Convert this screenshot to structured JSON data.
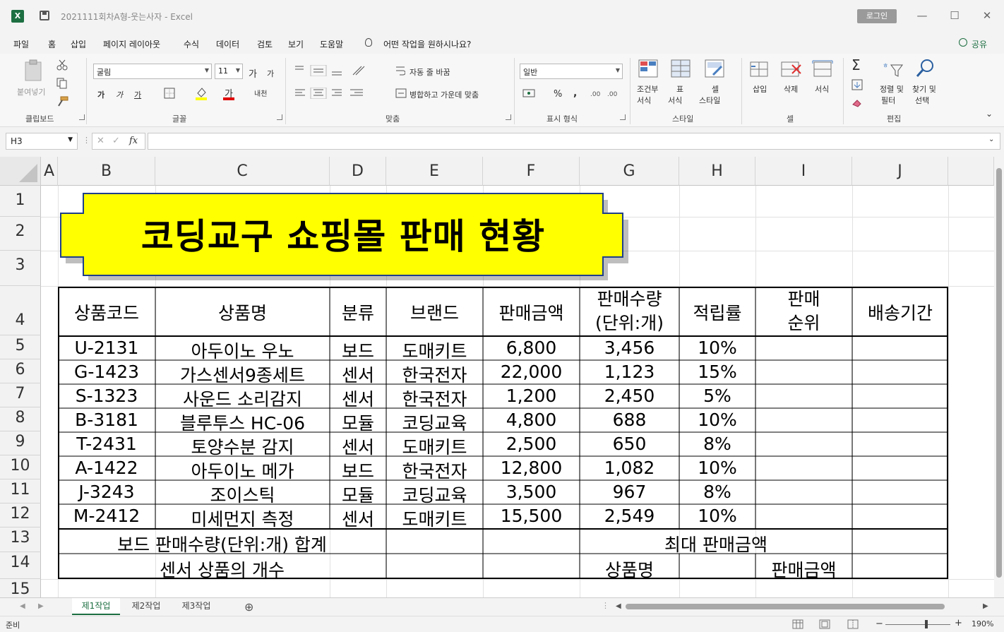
{
  "window": {
    "title": "2021111회차A형-웃는사자  -  Excel",
    "login_label": "로그인",
    "minimize_glyph": "—",
    "maximize_glyph": "☐",
    "close_glyph": "✕"
  },
  "menu": {
    "items": [
      "파일",
      "홈",
      "삽입",
      "페이지 레이아웃",
      "수식",
      "데이터",
      "검토",
      "보기",
      "도움말"
    ],
    "tell_me": "어떤 작업을 원하시나요?",
    "share": "공유"
  },
  "ribbon": {
    "clipboard": {
      "paste": "붙여넣기",
      "label": "클립보드"
    },
    "font": {
      "name": "굴림",
      "size": "11",
      "grow": "가",
      "shrink": "가",
      "bold": "가",
      "italic": "가",
      "underline": "가",
      "color_a": "가",
      "phonetic": "내천",
      "label": "글꼴"
    },
    "alignment": {
      "wrap": "자동 줄 바꿈",
      "merge": "병합하고 가운데 맞춤",
      "label": "맞춤"
    },
    "number": {
      "format": "일반",
      "percent": "%",
      "comma": ",",
      "label": "표시 형식"
    },
    "styles": {
      "conditional_1": "조건부",
      "conditional_2": "서식",
      "table_1": "표",
      "table_2": "서식",
      "cell_1": "셀",
      "cell_2": "스타일",
      "label": "스타일"
    },
    "cells": {
      "insert": "삽입",
      "delete": "삭제",
      "format": "서식",
      "label": "셀"
    },
    "editing": {
      "sort_1": "정렬 및",
      "sort_2": "필터",
      "find_1": "찾기 및",
      "find_2": "선택",
      "label": "편집"
    },
    "accent": "#1d6f42"
  },
  "formula_bar": {
    "name_box": "H3",
    "fx": "fx",
    "formula": ""
  },
  "sheet": {
    "columns": [
      "A",
      "B",
      "C",
      "D",
      "E",
      "F",
      "G",
      "H",
      "I",
      "J"
    ],
    "rows": [
      "1",
      "2",
      "3",
      "4",
      "5",
      "6",
      "7",
      "8",
      "9",
      "10",
      "11",
      "12",
      "13",
      "14",
      "15"
    ],
    "title": "코딩교구 쇼핑몰 판매 현황",
    "title_fill": "#ffff00",
    "headers": {
      "code": "상품코드",
      "name": "상품명",
      "category": "분류",
      "brand": "브랜드",
      "sales": "판매금액",
      "qty_1": "판매수량",
      "qty_2": "(단위:개)",
      "rate": "적립률",
      "rank_1": "판매",
      "rank_2": "순위",
      "ship": "배송기간"
    },
    "records": [
      {
        "code": "U-2131",
        "name": "아두이노 우노",
        "category": "보드",
        "brand": "도매키트",
        "sales": "6,800",
        "qty": "3,456",
        "rate": "10%"
      },
      {
        "code": "G-1423",
        "name": "가스센서9종세트",
        "category": "센서",
        "brand": "한국전자",
        "sales": "22,000",
        "qty": "1,123",
        "rate": "15%"
      },
      {
        "code": "S-1323",
        "name": "사운드 소리감지",
        "category": "센서",
        "brand": "한국전자",
        "sales": "1,200",
        "qty": "2,450",
        "rate": "5%"
      },
      {
        "code": "B-3181",
        "name": "블루투스 HC-06",
        "category": "모듈",
        "brand": "코딩교육",
        "sales": "4,800",
        "qty": "688",
        "rate": "10%"
      },
      {
        "code": "T-2431",
        "name": "토양수분 감지",
        "category": "센서",
        "brand": "도매키트",
        "sales": "2,500",
        "qty": "650",
        "rate": "8%"
      },
      {
        "code": "A-1422",
        "name": "아두이노 메가",
        "category": "보드",
        "brand": "한국전자",
        "sales": "12,800",
        "qty": "1,082",
        "rate": "10%"
      },
      {
        "code": "J-3243",
        "name": "조이스틱",
        "category": "모듈",
        "brand": "코딩교육",
        "sales": "3,500",
        "qty": "967",
        "rate": "8%"
      },
      {
        "code": "M-2412",
        "name": "미세먼지 측정",
        "category": "센서",
        "brand": "도매키트",
        "sales": "15,500",
        "qty": "2,549",
        "rate": "10%"
      }
    ],
    "summary": {
      "board_qty_sum": "보드 판매수량(단위:개) 합계",
      "max_sales": "최대 판매금액",
      "sensor_count": "센서 상품의 개수",
      "product_name": "상품명",
      "sales_amount": "판매금액"
    }
  },
  "tabs": {
    "items": [
      "제1작업",
      "제2작업",
      "제3작업"
    ],
    "add": "⊕"
  },
  "status": {
    "ready": "준비",
    "zoom": "190%",
    "zoom_out": "−",
    "zoom_in": "+"
  }
}
